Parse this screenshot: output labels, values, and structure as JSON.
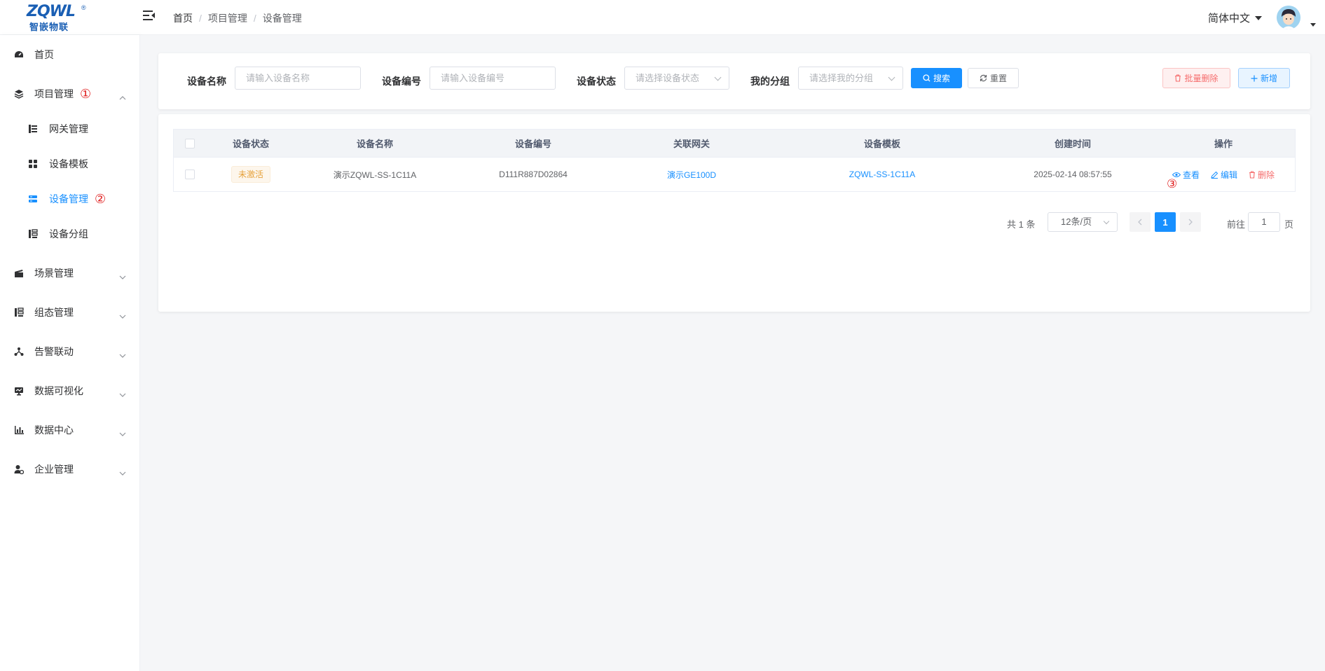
{
  "header": {
    "logo_brand": "ZQWL",
    "logo_sub": "智嵌物联",
    "breadcrumb": [
      "首页",
      "项目管理",
      "设备管理"
    ],
    "breadcrumb_sep": "/",
    "language": "简体中文"
  },
  "sidebar": {
    "items": [
      {
        "label": "首页",
        "icon": "dashboard-icon"
      },
      {
        "label": "项目管理",
        "icon": "layers-icon",
        "expanded": true,
        "marker": "①"
      },
      {
        "label": "网关管理",
        "icon": "gateway-icon"
      },
      {
        "label": "设备模板",
        "icon": "grid-icon"
      },
      {
        "label": "设备管理",
        "icon": "device-list-icon",
        "active": true,
        "marker": "②"
      },
      {
        "label": "设备分组",
        "icon": "group-icon"
      },
      {
        "label": "场景管理",
        "icon": "clapper-icon"
      },
      {
        "label": "组态管理",
        "icon": "config-icon"
      },
      {
        "label": "告警联动",
        "icon": "alarm-link-icon"
      },
      {
        "label": "数据可视化",
        "icon": "monitor-icon"
      },
      {
        "label": "数据中心",
        "icon": "bar-chart-icon"
      },
      {
        "label": "企业管理",
        "icon": "enterprise-icon"
      }
    ]
  },
  "search": {
    "name_label": "设备名称",
    "name_placeholder": "请输入设备名称",
    "code_label": "设备编号",
    "code_placeholder": "请输入设备编号",
    "status_label": "设备状态",
    "status_placeholder": "请选择设备状态",
    "group_label": "我的分组",
    "group_placeholder": "请选择我的分组",
    "search_btn": "搜索",
    "reset_btn": "重置",
    "batch_delete_btn": "批量删除",
    "add_btn": "新增"
  },
  "table": {
    "columns": [
      "设备状态",
      "设备名称",
      "设备编号",
      "关联网关",
      "设备模板",
      "创建时间",
      "操作"
    ],
    "rows": [
      {
        "status": "未激活",
        "name": "演示ZQWL-SS-1C11A",
        "code": "D111R887D02864",
        "gateway": "演示GE100D",
        "template": "ZQWL-SS-1C11A",
        "created": "2025-02-14 08:57:55",
        "actions": {
          "view": "查看",
          "edit": "编辑",
          "delete": "删除"
        },
        "marker": "③"
      }
    ]
  },
  "pagination": {
    "total": "共 1 条",
    "page_size": "12条/页",
    "current": "1",
    "goto_label": "前往",
    "goto_value": "1",
    "page_suffix": "页"
  },
  "colors": {
    "primary": "#1890ff",
    "danger": "#f56c6c",
    "warning": "#e6a23c",
    "annotation": "#e02020"
  }
}
